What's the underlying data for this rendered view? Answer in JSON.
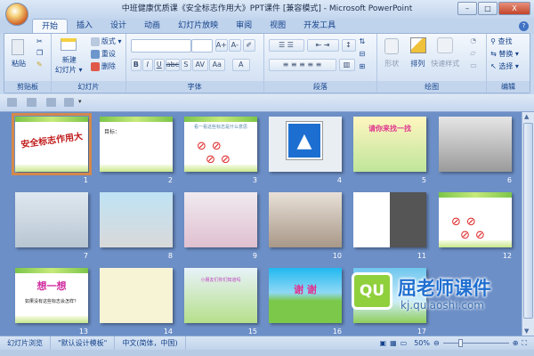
{
  "window": {
    "title": "中班健康优质课《安全标志作用大》PPT课件 [兼容模式] - Microsoft PowerPoint",
    "minimize": "–",
    "maximize": "□",
    "close": "X"
  },
  "tabs": [
    "开始",
    "插入",
    "设计",
    "动画",
    "幻灯片放映",
    "审阅",
    "视图",
    "开发工具"
  ],
  "ribbon": {
    "clipboard": {
      "label": "剪贴板",
      "paste": "粘贴"
    },
    "slides": {
      "label": "幻灯片",
      "new_slide": "新建",
      "new_slide2": "幻灯片 ▾",
      "layout": "版式 ▾",
      "reset": "重设",
      "delete": "删除"
    },
    "font": {
      "label": "字体",
      "bold": "B",
      "italic": "I",
      "underline": "U",
      "strike": "abc",
      "shadow": "S",
      "spacing": "AV",
      "case": "Aa",
      "color": "A",
      "grow": "A+",
      "shrink": "A-"
    },
    "paragraph": {
      "label": "段落"
    },
    "drawing": {
      "label": "绘图",
      "shapes": "形状",
      "arrange": "排列",
      "quick_styles": "快速样式"
    },
    "editing": {
      "label": "编辑",
      "find": "查找",
      "replace": "替换 ▾",
      "select": "选择 ▾"
    }
  },
  "slides": [
    {
      "num": "1",
      "title": "安全标志作用大",
      "selected": true
    },
    {
      "num": "2",
      "title": "目标："
    },
    {
      "num": "3",
      "title": "看一看这些标志是什么意思"
    },
    {
      "num": "4",
      "title": ""
    },
    {
      "num": "5",
      "title": "请你来找一找"
    },
    {
      "num": "6",
      "title": ""
    },
    {
      "num": "7",
      "title": ""
    },
    {
      "num": "8",
      "title": ""
    },
    {
      "num": "9",
      "title": ""
    },
    {
      "num": "10",
      "title": ""
    },
    {
      "num": "11",
      "title": ""
    },
    {
      "num": "12",
      "title": ""
    },
    {
      "num": "13",
      "title": "想一想",
      "subtitle": "如果没有这些标志会怎样？"
    },
    {
      "num": "14",
      "title": ""
    },
    {
      "num": "15",
      "title": "小朋友们你们知道吗"
    },
    {
      "num": "16",
      "title": "谢 谢"
    },
    {
      "num": "17",
      "title": ""
    }
  ],
  "watermark": {
    "logo": "QU",
    "name": "屈老师课件",
    "url": "kj.qulaoshi.com"
  },
  "status": {
    "view": "幻灯片浏览",
    "theme": "\"默认设计模板\"",
    "language": "中文(简体，中国)",
    "zoom": "50%",
    "zoom_level_percent": 50
  }
}
